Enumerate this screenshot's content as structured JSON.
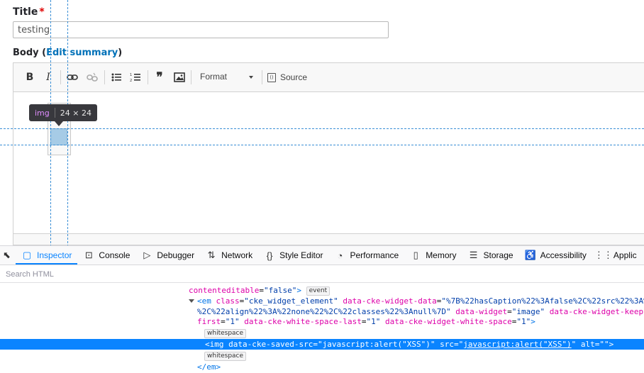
{
  "form": {
    "title_label": "Title",
    "required_mark": "*",
    "title_value": "testing",
    "body_label": "Body",
    "body_paren_open": "(",
    "edit_summary_link": "Edit summary",
    "body_paren_close": ")"
  },
  "editor": {
    "toolbar": {
      "bold": "B",
      "italic": "I",
      "format_label": "Format",
      "source_label": "Source",
      "icons": [
        "bold-icon",
        "italic-icon",
        "link-icon",
        "unlink-icon",
        "bulleted-list-icon",
        "numbered-list-icon",
        "blockquote-icon",
        "image-icon",
        "source-icon"
      ]
    },
    "highlight": {
      "tag": "img",
      "dimensions": "24 × 24",
      "guide_color": "#3a8fd6",
      "box_color": "#a6cbe6"
    }
  },
  "devtools": {
    "tabs": [
      {
        "label": "Inspector",
        "icon": "inspector-icon",
        "active": true
      },
      {
        "label": "Console",
        "icon": "console-icon"
      },
      {
        "label": "Debugger",
        "icon": "debugger-icon"
      },
      {
        "label": "Network",
        "icon": "network-icon"
      },
      {
        "label": "Style Editor",
        "icon": "style-editor-icon"
      },
      {
        "label": "Performance",
        "icon": "performance-icon"
      },
      {
        "label": "Memory",
        "icon": "memory-icon"
      },
      {
        "label": "Storage",
        "icon": "storage-icon"
      },
      {
        "label": "Accessibility",
        "icon": "accessibility-icon"
      },
      {
        "label": "Applic",
        "icon": "application-icon"
      }
    ],
    "search_placeholder": "Search HTML",
    "accent_color": "#0a84ff",
    "markup": {
      "l1_attr": "contenteditable",
      "l1_val": "\"false\"",
      "l1_close": ">",
      "event_badge": "event",
      "l2_open": "<em",
      "l2_a1": "class",
      "l2_v1": "\"cke_widget_element\"",
      "l2_a2": "data-cke-widget-data",
      "l2_v2": "\"%7B%22hasCaption%22%3Afalse%2C%22src%22%3A%",
      "l3_v2": "%2C%22align%22%3A%22none%22%2C%22classes%22%3Anull%7D\"",
      "l3_a3": "data-widget",
      "l3_v3": "\"image\"",
      "l3_a4": "data-cke-widget-keep-",
      "l4_a4": "first",
      "l4_v4": "\"1\"",
      "l4_a5": "data-cke-white-space-last",
      "l4_v5": "\"1\"",
      "l4_a6": "data-cke-widget-white-space",
      "l4_v6": "\"1\"",
      "l4_close": ">",
      "whitespace_badge": "whitespace",
      "sel_open": "<img",
      "sel_a1": "data-cke-saved-src",
      "sel_v1": "\"javascript:alert(\"XSS\")\"",
      "sel_a2": "src",
      "sel_v2_q1": "\"",
      "sel_v2_link": "javascript:alert(\"XSS\")",
      "sel_v2_q2": "\"",
      "sel_a3": "alt",
      "sel_v3": "\"\"",
      "sel_close": ">",
      "end_tag": "</em>"
    }
  }
}
